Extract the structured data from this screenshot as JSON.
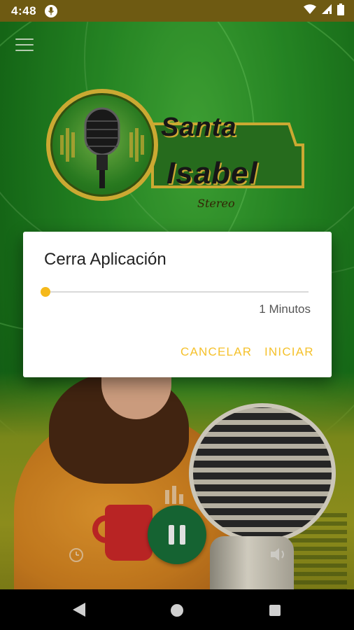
{
  "status_bar": {
    "time": "4:48",
    "icons": [
      "mic-icon",
      "wifi-icon",
      "signal-icon",
      "battery-icon"
    ]
  },
  "app": {
    "logo": {
      "line1": "Santa",
      "line2": "Isabel",
      "tagline": "Stereo"
    },
    "menu_icon": "hamburger-menu-icon",
    "player": {
      "state": "playing",
      "buttons": [
        "timer-icon",
        "pause-icon",
        "volume-icon"
      ]
    }
  },
  "dialog": {
    "title": "Cerra Aplicación",
    "slider": {
      "value": 1,
      "fraction": 0.0,
      "label": "1 Minutos"
    },
    "cancel_label": "CANCELAR",
    "start_label": "INICIAR"
  },
  "colors": {
    "accent": "#f5c12b",
    "status_bar": "#6e5a12",
    "play_button": "#19713a",
    "background_green": "#2a9628"
  },
  "nav_bar": {
    "buttons": [
      "back-icon",
      "home-icon",
      "recents-icon"
    ]
  }
}
